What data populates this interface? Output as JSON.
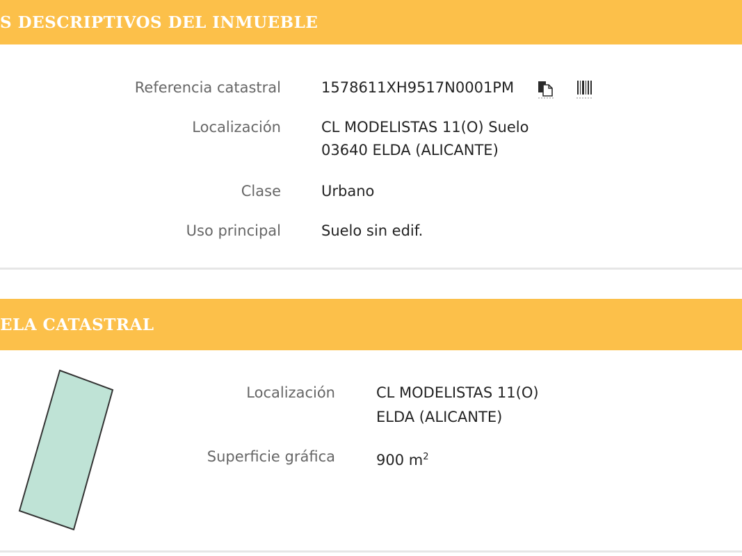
{
  "descriptive": {
    "header": "S DESCRIPTIVOS DEL INMUEBLE",
    "rows": {
      "ref": {
        "label": "Referencia catastral",
        "value": "1578611XH9517N0001PM"
      },
      "loc": {
        "label": "Localización",
        "line1": "CL MODELISTAS 11(O) Suelo",
        "line2": "03640 ELDA (ALICANTE)"
      },
      "clase": {
        "label": "Clase",
        "value": "Urbano"
      },
      "uso": {
        "label": "Uso principal",
        "value": "Suelo sin edif."
      }
    },
    "icons": [
      "copy-icon",
      "barcode-icon"
    ]
  },
  "parcel": {
    "header": "ELA CATASTRAL",
    "rows": {
      "loc": {
        "label": "Localización",
        "line1": "CL MODELISTAS 11(O)",
        "line2": "ELDA (ALICANTE)"
      },
      "superficie": {
        "label": "Superficie gráfica",
        "value": "900 m",
        "unit_sup": "2"
      }
    }
  },
  "colors": {
    "header_bg": "#fcc04a",
    "header_text": "#ffffff",
    "label_text": "#666666",
    "value_text": "#222222",
    "parcel_fill": "#bfe3d6",
    "parcel_stroke": "#333333",
    "separator": "#e6e6e6"
  }
}
